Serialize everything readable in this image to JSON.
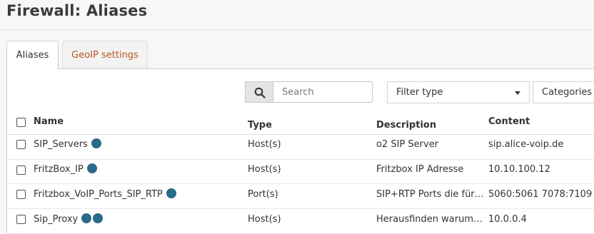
{
  "page": {
    "title": "Firewall: Aliases"
  },
  "tabs": [
    {
      "label": "Aliases",
      "active": true
    },
    {
      "label": "GeoIP settings",
      "active": false
    }
  ],
  "toolbar": {
    "search_icon": "search-icon",
    "search_placeholder": "Search",
    "filter_type": "Filter type",
    "categories": "Categories"
  },
  "table": {
    "headers": {
      "name": "Name",
      "type": "Type",
      "description": "Description",
      "content": "Content"
    },
    "rows": [
      {
        "name": "SIP_Servers",
        "type": "Host(s)",
        "description": "o2 SIP Server",
        "content": "sip.alice-voip.de",
        "dots": 1
      },
      {
        "name": "FritzBox_IP",
        "type": "Host(s)",
        "description": "Fritzbox IP Adresse",
        "content": "10.10.100.12",
        "dots": 1
      },
      {
        "name": "Fritzbox_VoIP_Ports_SIP_RTP",
        "type": "Port(s)",
        "description": "SIP+RTP Ports die für…",
        "content": "5060:5061 7078:7109",
        "dots": 1
      },
      {
        "name": "Sip_Proxy",
        "type": "Host(s)",
        "description": "Herausfinden warum…",
        "content": "10.0.0.4",
        "dots": 2
      }
    ]
  },
  "colors": {
    "accent": "#b8551d",
    "dot": "#2a6a8a"
  }
}
